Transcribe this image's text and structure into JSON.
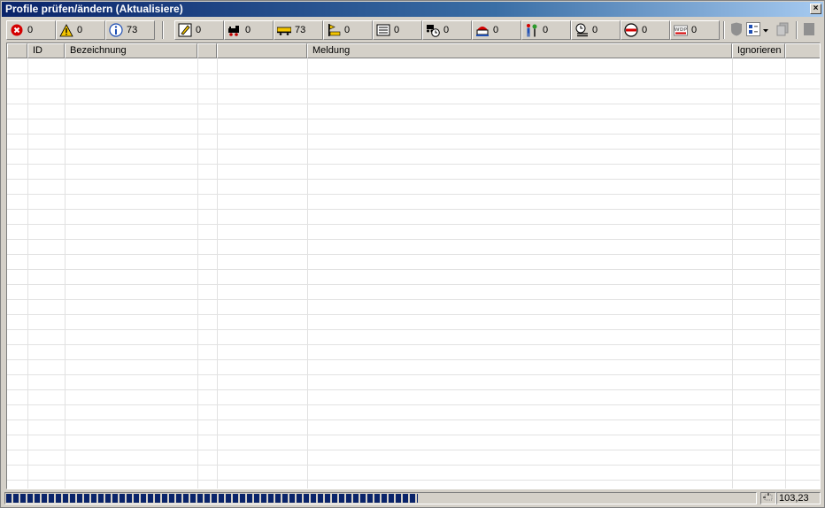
{
  "window": {
    "title": "Profile prüfen/ändern (Aktualisiere)",
    "close_glyph": "×"
  },
  "toolbar": {
    "groups": [
      {
        "name": "errors",
        "icon": "error-icon",
        "count": "0"
      },
      {
        "name": "warnings",
        "icon": "warning-icon",
        "count": "0"
      },
      {
        "name": "infos",
        "icon": "info-icon",
        "count": "73"
      },
      {
        "name": "edit",
        "icon": "pencil-icon",
        "count": "0"
      },
      {
        "name": "locomotive",
        "icon": "locomotive-icon",
        "count": "0"
      },
      {
        "name": "wagon",
        "icon": "wagon-icon",
        "count": "73"
      },
      {
        "name": "signal",
        "icon": "signal-icon",
        "count": "0"
      },
      {
        "name": "timetable",
        "icon": "timetable-icon",
        "count": "0"
      },
      {
        "name": "loco-clock",
        "icon": "loco-clock-icon",
        "count": "0"
      },
      {
        "name": "station",
        "icon": "station-icon",
        "count": "0"
      },
      {
        "name": "personnel",
        "icon": "personnel-icon",
        "count": "0"
      },
      {
        "name": "schedule",
        "icon": "schedule-icon",
        "count": "0"
      },
      {
        "name": "restriction",
        "icon": "no-entry-icon",
        "count": "0"
      },
      {
        "name": "wdp",
        "icon": "wdp-icon",
        "count": "0"
      }
    ],
    "colors": {
      "error": "#d40000",
      "warning": "#f2c400",
      "info": "#1f4fb4"
    }
  },
  "grid": {
    "columns": [
      "",
      "ID",
      "Bezeichnung",
      "",
      "",
      "Meldung",
      "Ignorieren",
      ""
    ],
    "rows": []
  },
  "status": {
    "progress": 0.55,
    "coords": "103,23"
  }
}
